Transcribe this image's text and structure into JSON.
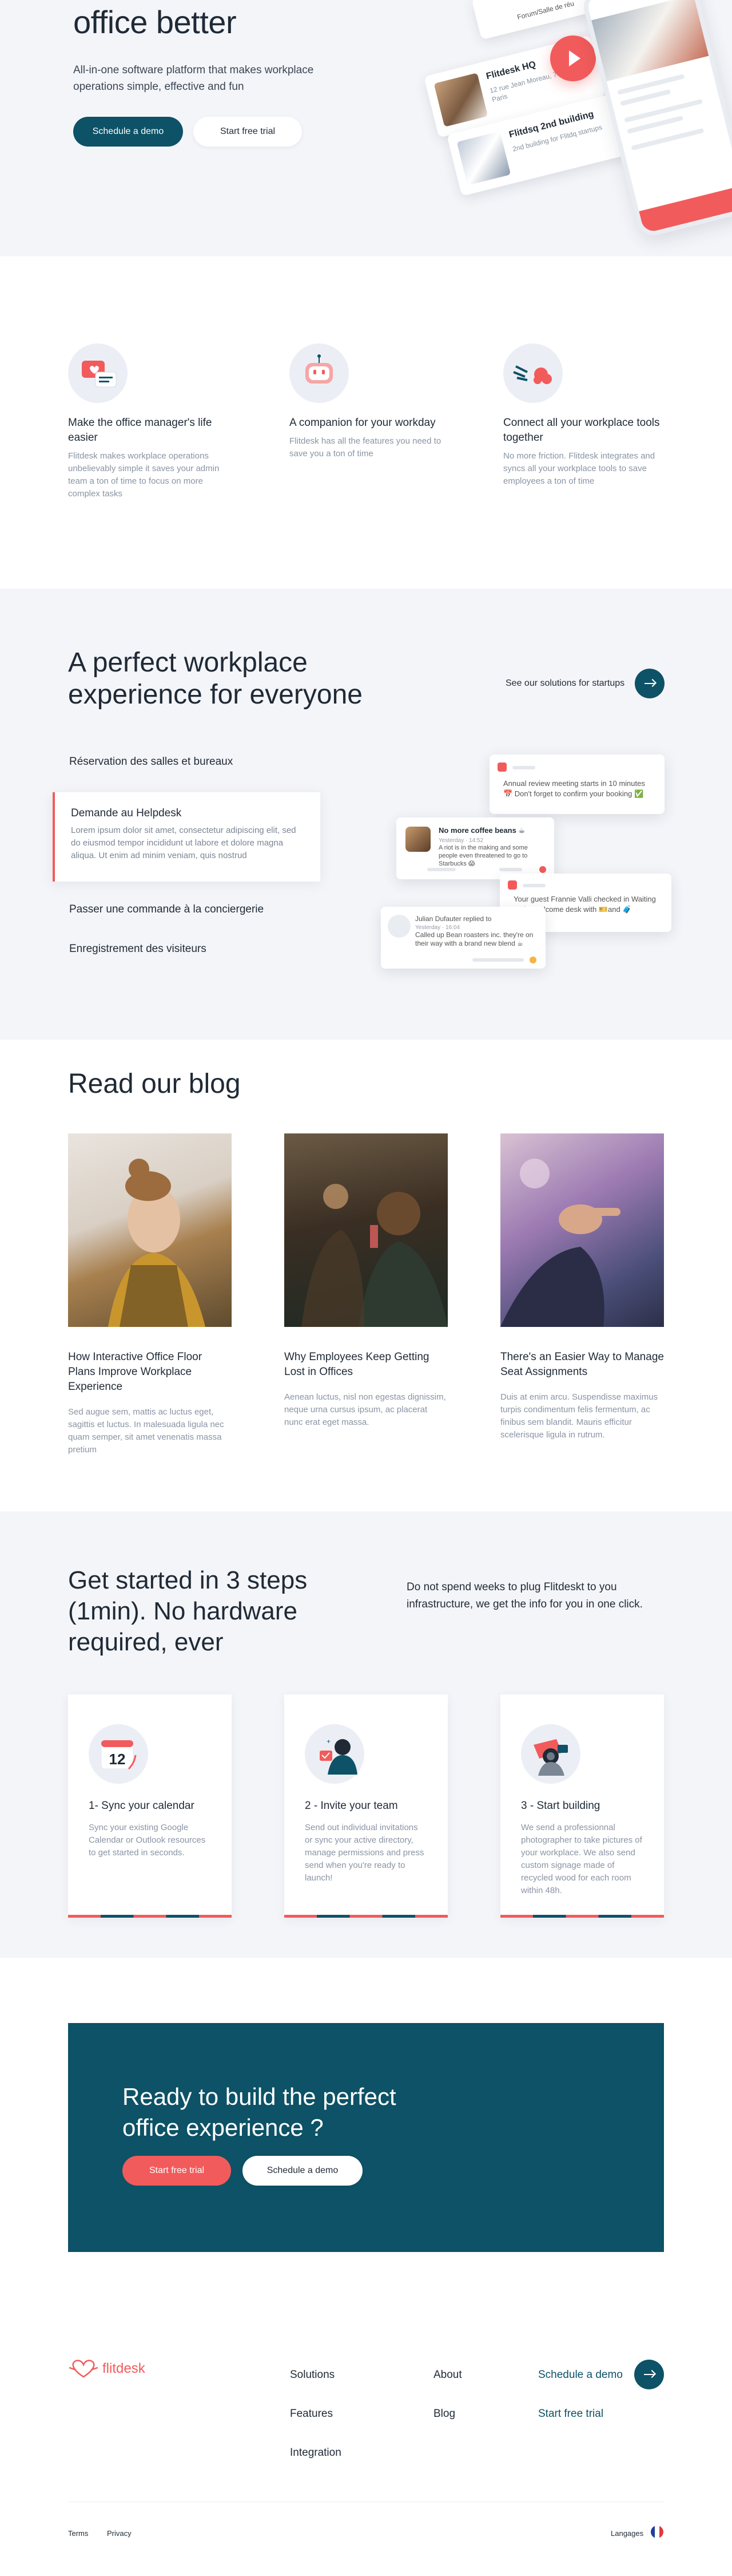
{
  "hero": {
    "title": "office better",
    "subtitle": "All-in-one software platform that makes workplace operations simple, effective and fun",
    "primary_button": "Schedule a demo",
    "secondary_button": "Start free trial",
    "card_top": "Forum/Salle de réu",
    "card1_title": "Flitdesk HQ",
    "card1_sub": "12 rue Jean Moreau, 75018 Paris",
    "card2_title": "Flitdsq 2nd building",
    "card2_sub": "2nd building for Flitdq startups"
  },
  "features": [
    {
      "title": "Make the office manager's life easier",
      "desc": "Flitdesk makes workplace operations unbelievably simple it saves your admin team a ton of time to focus on more complex tasks",
      "icon": "chat-bubble-heart-icon"
    },
    {
      "title": "A companion for your workday",
      "desc": "Flitdesk has all the features you need to save you a ton of time",
      "icon": "robot-companion-icon"
    },
    {
      "title": "Connect all your workplace tools together",
      "desc": "No more friction. Flitdesk integrates and syncs all your workplace tools to save employees a ton of time",
      "icon": "plug-connect-icon"
    }
  ],
  "workplace": {
    "title": "A perfect workplace experience for everyone",
    "startups_link": "See our solutions for startups",
    "tabs": [
      "Réservation des salles et bureaux",
      "Passer une commande à la conciergerie",
      "Enregistrement des visiteurs"
    ],
    "active_tab": {
      "title": "Demande au Helpdesk",
      "desc": "Lorem ipsum dolor sit amet, consectetur adipiscing elit, sed do eiusmod tempor incididunt ut labore et dolore magna aliqua. Ut enim ad minim veniam, quis nostrud"
    },
    "notifications": {
      "n1": "Annual review meeting starts in 10 minutes 📅 Don't forget to confirm your booking ✅",
      "n2_title": "No more coffee beans ☕",
      "n2_meta": "Yesterday · 14:52",
      "n2_body": "A riot is in the making and some people even threatened to go to Starbucks 😱",
      "n3": "Your guest Frannie Valli checked in Waiting at the welcome desk with 🎫and 🧳",
      "n4_title": "Julian Dufauter replied to",
      "n4_meta": "Yesterday · 16:04",
      "n4_body": "Called up Bean roasters inc. they're on their way with a brand new blend ☕"
    }
  },
  "blog": {
    "title": "Read our blog",
    "posts": [
      {
        "title": "How Interactive Office Floor Plans Improve Workplace Experience",
        "desc": "Sed augue sem, mattis ac luctus eget, sagittis et luctus. In malesuada ligula nec quam semper, sit amet venenatis massa pretium"
      },
      {
        "title": "Why Employees Keep Getting Lost in Offices",
        "desc": "Aenean luctus, nisl non egestas dignissim, neque urna cursus ipsum, ac placerat nunc erat eget massa."
      },
      {
        "title": "There's an Easier Way to Manage Seat Assignments",
        "desc": "Duis at enim arcu. Suspendisse maximus turpis condimentum felis fermentum, ac finibus sem blandit. Mauris efficitur scelerisque ligula in rutrum."
      }
    ]
  },
  "steps": {
    "title": "Get started in 3 steps (1min). No hardware required, ever",
    "lead": "Do not spend weeks to plug Flitdeskt to you infrastructure, we get the info for you in one click.",
    "calendar_number": "12",
    "items": [
      {
        "title": "1- Sync your calendar",
        "desc": "Sync your existing Google Calendar or Outlook resources to get started in seconds.",
        "icon": "calendar-icon"
      },
      {
        "title": "2 - Invite your team",
        "desc": "Send out individual invitations or sync your active directory, manage permissions and press send when you're ready to launch!",
        "icon": "team-invite-icon"
      },
      {
        "title": "3 - Start building",
        "desc": "We send a professionnal photographer to take pictures of your workplace. We also send custom signage made of recycled wood for each room within 48h.",
        "icon": "photographer-icon"
      }
    ]
  },
  "cta": {
    "title": "Ready to build the perfect office experience ?",
    "primary": "Start free trial",
    "secondary": "Schedule a demo"
  },
  "footer": {
    "logo": "flitdesk",
    "col1": [
      "Solutions",
      "Features",
      "Integration"
    ],
    "col2": [
      "About",
      "Blog"
    ],
    "schedule": "Schedule a demo",
    "trial": "Start free trial",
    "terms": "Terms",
    "privacy": "Privacy",
    "languages": "Langages"
  },
  "colors": {
    "teal": "#0d5266",
    "coral": "#f25b5b",
    "light_bg": "#f4f5f9"
  }
}
